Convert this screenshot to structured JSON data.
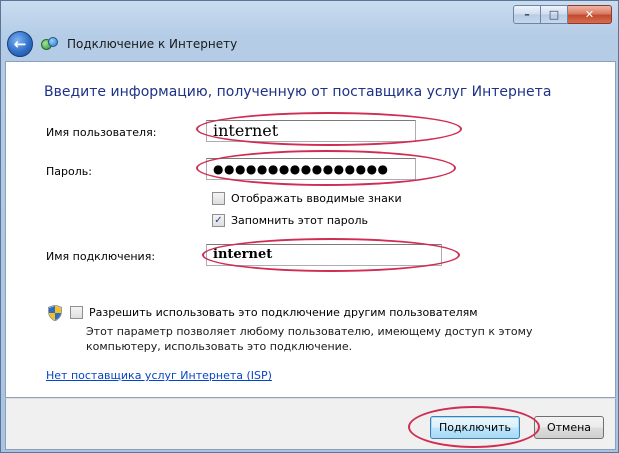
{
  "window": {
    "title": "Подключение к Интернету",
    "caption_min": "–",
    "caption_max": "□",
    "caption_close": "✕",
    "back_glyph": "←"
  },
  "form": {
    "heading": "Введите информацию, полученную от поставщика услуг Интернета",
    "username_label": "Имя пользователя:",
    "username_value": "internet",
    "password_label": "Пароль:",
    "password_value": "●●●●●●●●●●●●●●●●",
    "show_chars_label": "Отображать вводимые знаки",
    "show_chars_checked": false,
    "remember_label": "Запомнить этот пароль",
    "remember_checked": true,
    "remember_mark": "✓",
    "connection_name_label": "Имя подключения:",
    "connection_name_value": "internet",
    "allow_others_label": "Разрешить использовать это подключение другим пользователям",
    "allow_others_checked": false,
    "allow_others_note": "Этот параметр позволяет любому пользователю, имеющему доступ к этому компьютеру, использовать это подключение.",
    "no_isp_link": "Нет поставщика услуг Интернета (ISP)"
  },
  "footer": {
    "connect_label": "Подключить",
    "cancel_label": "Отмена"
  },
  "colors": {
    "heading": "#1e3287",
    "annotation_ellipse": "#cf2d52",
    "link": "#0645c8"
  }
}
